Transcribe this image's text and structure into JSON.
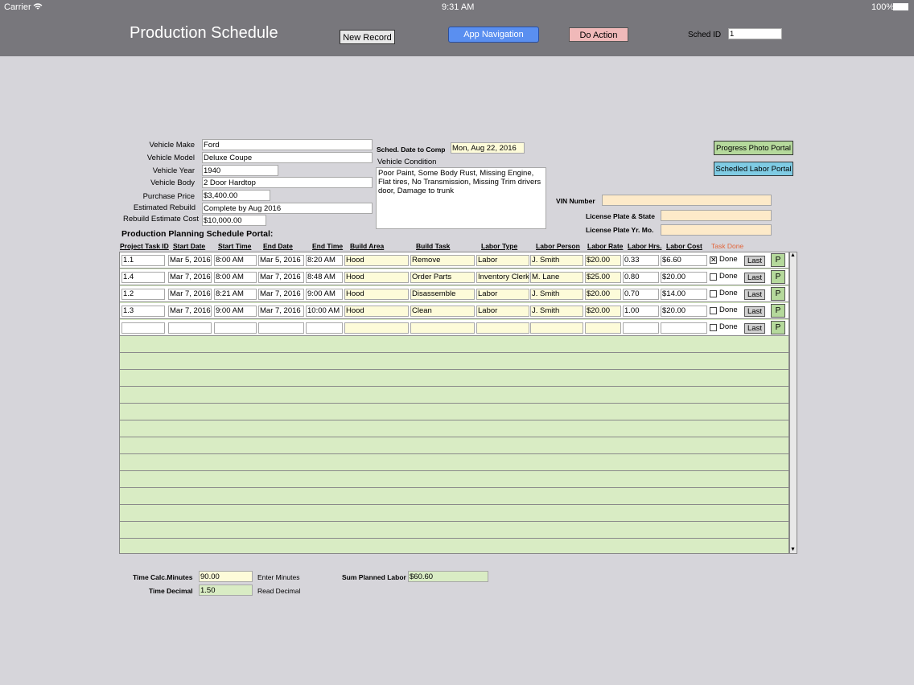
{
  "status_bar": {
    "carrier": "Carrier",
    "time": "9:31 AM",
    "battery": "100%",
    "wifi_icon": "wifi-icon"
  },
  "header": {
    "title": "Production Schedule",
    "new_record": "New Record",
    "app_navigation": "App Navigation",
    "do_action": "Do Action",
    "sched_id_label": "Sched ID",
    "sched_id_value": "1"
  },
  "vehicle": {
    "make_label": "Vehicle Make",
    "make": "Ford",
    "model_label": "Vehicle Model",
    "model": "Deluxe Coupe",
    "year_label": "Vehicle Year",
    "year": "1940",
    "body_label": "Vehicle Body",
    "body": "2 Door Hardtop",
    "price_label": "Purchase Price",
    "price": "$3,400.00",
    "est_rebuild_label": "Estimated Rebuild",
    "est_rebuild": "Complete by Aug 2016",
    "rebuild_cost_label": "Rebuild Estimate Cost",
    "rebuild_cost": "$10,000.00"
  },
  "sched_date_label": "Sched. Date to Comp",
  "sched_date": "Mon, Aug 22, 2016",
  "condition_label": "Vehicle Condition",
  "condition": "Poor Paint, Some Body Rust, Missing Engine, Flat tires, No Transmission, Missing Trim drivers door, Damage to trunk",
  "portal_buttons": {
    "photo": "Progress Photo Portal",
    "labor": "Schedled Labor Portal"
  },
  "vin_label": "VIN Number",
  "plate_label": "License Plate & State",
  "plate_yr_label": "License Plate Yr. Mo.",
  "portal_title": "Production Planning Schedule Portal:",
  "columns": [
    "Project Task ID",
    "Start Date",
    "Start Time",
    "End Date",
    "End Time",
    "Build Area",
    "Build Task",
    "Labor Type",
    "Labor Person",
    "Labor Rate",
    "Labor Hrs.",
    "Labor Cost",
    "Task Done"
  ],
  "rows": [
    {
      "id": "1.1",
      "start_date": "Mar 5, 2016",
      "start_time": "8:00 AM",
      "end_date": "Mar 5, 2016",
      "end_time": "8:20 AM",
      "area": "Hood",
      "task": "Remove",
      "labor_type": "Labor",
      "person": "J. Smith",
      "rate": "$20.00",
      "hrs": "0.33",
      "cost": "$6.60",
      "done": true
    },
    {
      "id": "1.4",
      "start_date": "Mar 7, 2016",
      "start_time": "8:00 AM",
      "end_date": "Mar 7, 2016",
      "end_time": "8:48 AM",
      "area": "Hood",
      "task": "Order Parts",
      "labor_type": "Inventory Clerk",
      "person": "M. Lane",
      "rate": "$25.00",
      "hrs": "0.80",
      "cost": "$20.00",
      "done": false
    },
    {
      "id": "1.2",
      "start_date": "Mar 7, 2016",
      "start_time": "8:21 AM",
      "end_date": "Mar 7, 2016",
      "end_time": "9:00 AM",
      "area": "Hood",
      "task": "Disassemble",
      "labor_type": "Labor",
      "person": "J. Smith",
      "rate": "$20.00",
      "hrs": "0.70",
      "cost": "$14.00",
      "done": false
    },
    {
      "id": "1.3",
      "start_date": "Mar 7, 2016",
      "start_time": "9:00 AM",
      "end_date": "Mar 7, 2016",
      "end_time": "10:00 AM",
      "area": "Hood",
      "task": "Clean",
      "labor_type": "Labor",
      "person": "J. Smith",
      "rate": "$20.00",
      "hrs": "1.00",
      "cost": "$20.00",
      "done": false
    },
    {
      "id": "",
      "start_date": "",
      "start_time": "",
      "end_date": "",
      "end_time": "",
      "area": "",
      "task": "",
      "labor_type": "",
      "person": "",
      "rate": "",
      "hrs": "",
      "cost": "",
      "done": false
    }
  ],
  "done_label": "Done",
  "last_label": "Last",
  "p_label": "P",
  "footer": {
    "calc_minutes_label": "Time Calc.Minutes",
    "calc_minutes": "90.00",
    "enter_minutes": "Enter Minutes",
    "decimal_label": "Time Decimal",
    "decimal": "1.50",
    "read_decimal": "Read Decimal",
    "sum_label": "Sum Planned Labor",
    "sum": "$60.60"
  }
}
